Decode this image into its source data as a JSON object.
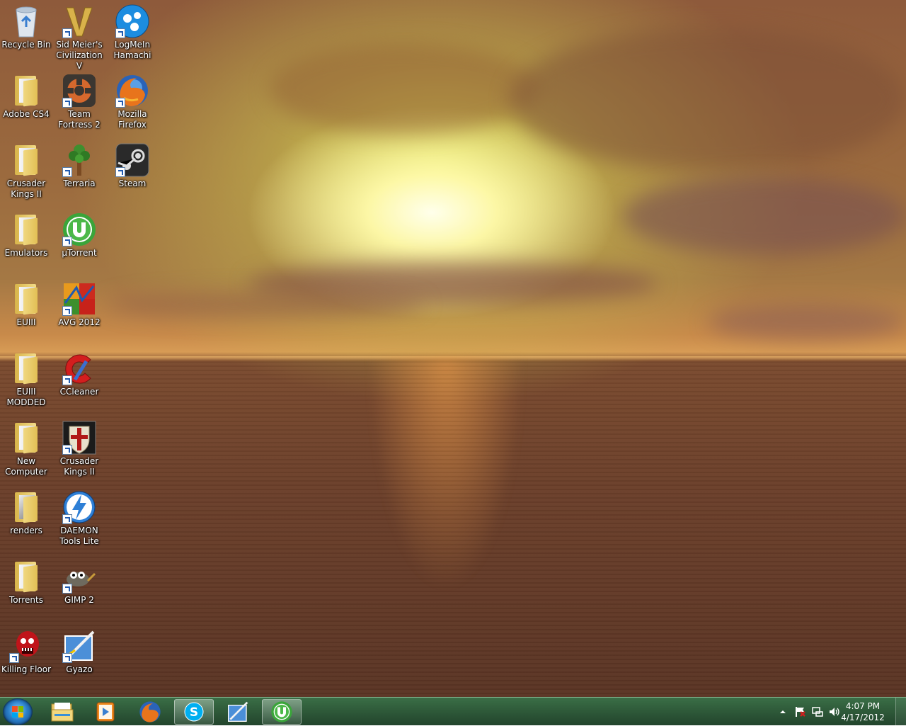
{
  "desktop": {
    "icons": [
      {
        "label": "Recycle Bin",
        "icon": "recycle-bin-icon",
        "shortcut": false
      },
      {
        "label": "Sid Meier's\nCivilization V",
        "icon": "civilization-icon",
        "shortcut": true
      },
      {
        "label": "LogMeIn\nHamachi",
        "icon": "hamachi-icon",
        "shortcut": true
      },
      {
        "label": "Adobe CS4",
        "icon": "folder-icon",
        "shortcut": false
      },
      {
        "label": "Team\nFortress 2",
        "icon": "tf2-icon",
        "shortcut": true
      },
      {
        "label": "Mozilla\nFirefox",
        "icon": "firefox-icon",
        "shortcut": true
      },
      {
        "label": "Crusader\nKings II",
        "icon": "folder-icon",
        "shortcut": false
      },
      {
        "label": "Terraria",
        "icon": "terraria-icon",
        "shortcut": true
      },
      {
        "label": "Steam",
        "icon": "steam-icon",
        "shortcut": true
      },
      {
        "label": "Emulators",
        "icon": "folder-icon",
        "shortcut": false
      },
      {
        "label": "µTorrent",
        "icon": "utorrent-icon",
        "shortcut": true
      },
      {
        "label": "EUIII",
        "icon": "folder-icon",
        "shortcut": false
      },
      {
        "label": "AVG 2012",
        "icon": "avg-icon",
        "shortcut": true
      },
      {
        "label": "EUIII\nMODDED",
        "icon": "folder-icon",
        "shortcut": false
      },
      {
        "label": "CCleaner",
        "icon": "ccleaner-icon",
        "shortcut": true
      },
      {
        "label": "New\nComputer",
        "icon": "folder-icon",
        "shortcut": false
      },
      {
        "label": "Crusader\nKings II",
        "icon": "crusader-kings-icon",
        "shortcut": true
      },
      {
        "label": "renders",
        "icon": "folder-icon",
        "shortcut": false
      },
      {
        "label": "DAEMON\nTools Lite",
        "icon": "daemon-tools-icon",
        "shortcut": true
      },
      {
        "label": "Torrents",
        "icon": "folder-icon",
        "shortcut": false
      },
      {
        "label": "GIMP 2",
        "icon": "gimp-icon",
        "shortcut": true
      },
      {
        "label": "Killing Floor",
        "icon": "killing-floor-icon",
        "shortcut": true
      },
      {
        "label": "Gyazo",
        "icon": "gyazo-icon",
        "shortcut": true
      }
    ]
  },
  "taskbar": {
    "start_icon": "windows-start-icon",
    "pinned": [
      {
        "icon": "explorer-icon",
        "active": false
      },
      {
        "icon": "media-player-icon",
        "active": false
      },
      {
        "icon": "firefox-icon",
        "active": false
      },
      {
        "icon": "skype-icon",
        "active": true
      },
      {
        "icon": "gyazo-icon",
        "active": false
      },
      {
        "icon": "utorrent-icon",
        "active": true
      }
    ],
    "tray_icons": [
      "show-hidden-icons-icon",
      "action-center-flag-icon",
      "network-icon",
      "volume-icon"
    ],
    "clock": {
      "time": "4:07 PM",
      "date": "4/17/2012"
    }
  },
  "colors": {
    "taskbar": "#2f5b3a",
    "utorrent": "#3aa53a",
    "skype": "#00aff0"
  }
}
